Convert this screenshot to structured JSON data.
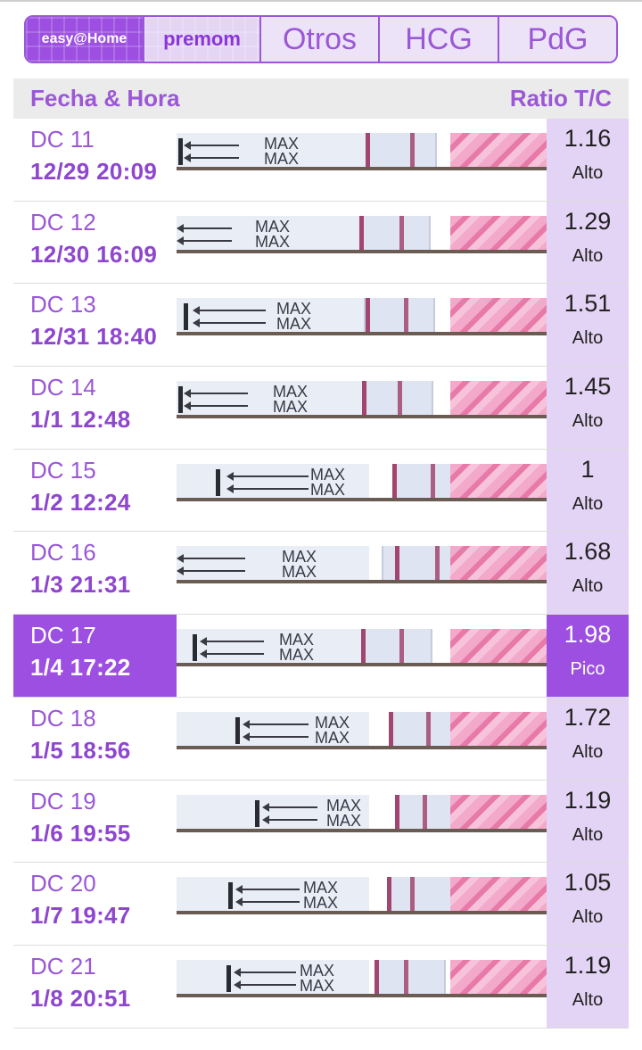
{
  "tabs": [
    {
      "label": "easy@Home",
      "active": true
    },
    {
      "label": "premom",
      "active": false
    },
    {
      "label": "Otros",
      "active": false
    },
    {
      "label": "HCG",
      "active": false
    },
    {
      "label": "PdG",
      "active": false
    }
  ],
  "table": {
    "header_left": "Fecha & Hora",
    "header_right": "Ratio T/C",
    "strip_text": "MAX\nMAX",
    "rows": [
      {
        "dc": "DC 11",
        "datetime": "12/29  20:09",
        "ratio": "1.16",
        "level": "Alto",
        "active": false
      },
      {
        "dc": "DC 12",
        "datetime": "12/30  16:09",
        "ratio": "1.29",
        "level": "Alto",
        "active": false
      },
      {
        "dc": "DC 13",
        "datetime": "12/31  18:40",
        "ratio": "1.51",
        "level": "Alto",
        "active": false
      },
      {
        "dc": "DC 14",
        "datetime": "1/1  12:48",
        "ratio": "1.45",
        "level": "Alto",
        "active": false
      },
      {
        "dc": "DC 15",
        "datetime": "1/2  12:24",
        "ratio": "1",
        "level": "Alto",
        "active": false
      },
      {
        "dc": "DC 16",
        "datetime": "1/3  21:31",
        "ratio": "1.68",
        "level": "Alto",
        "active": false
      },
      {
        "dc": "DC 17",
        "datetime": "1/4  17:22",
        "ratio": "1.98",
        "level": "Pico",
        "active": true
      },
      {
        "dc": "DC 18",
        "datetime": "1/5  18:56",
        "ratio": "1.72",
        "level": "Alto",
        "active": false
      },
      {
        "dc": "DC 19",
        "datetime": "1/6  19:55",
        "ratio": "1.19",
        "level": "Alto",
        "active": false
      },
      {
        "dc": "DC 20",
        "datetime": "1/7  19:47",
        "ratio": "1.05",
        "level": "Alto",
        "active": false
      },
      {
        "dc": "DC 21",
        "datetime": "1/8  20:51",
        "ratio": "1.19",
        "level": "Alto",
        "active": false
      }
    ]
  },
  "colors": {
    "accent": "#9c4fe0",
    "accent_light": "#e3d3f4",
    "header_bg": "#ebebeb",
    "strip_pink": "#e87aa9"
  }
}
